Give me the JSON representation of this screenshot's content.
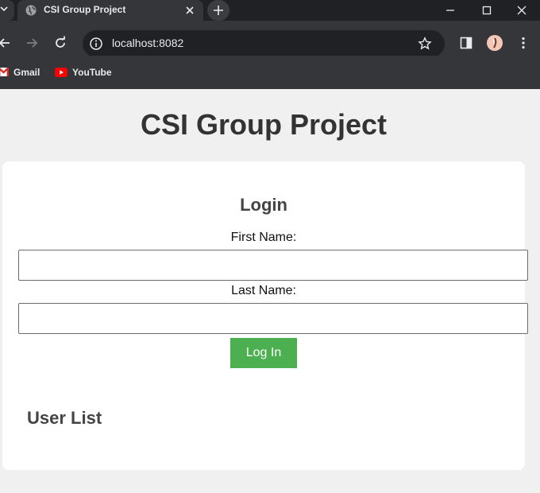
{
  "browser": {
    "tab_title": "CSI Group Project",
    "url": "localhost:8082",
    "bookmarks": [
      {
        "label": "Gmail",
        "icon": "gmail-icon"
      },
      {
        "label": "YouTube",
        "icon": "youtube-icon"
      }
    ]
  },
  "page": {
    "title": "CSI Group Project",
    "login": {
      "heading": "Login",
      "first_name_label": "First Name:",
      "first_name_value": "",
      "last_name_label": "Last Name:",
      "last_name_value": "",
      "submit_label": "Log In"
    },
    "user_list": {
      "heading": "User List",
      "users": []
    }
  },
  "colors": {
    "button_green": "#4caf50",
    "page_background": "#f0f0f0",
    "chrome_dark": "#35363a"
  }
}
